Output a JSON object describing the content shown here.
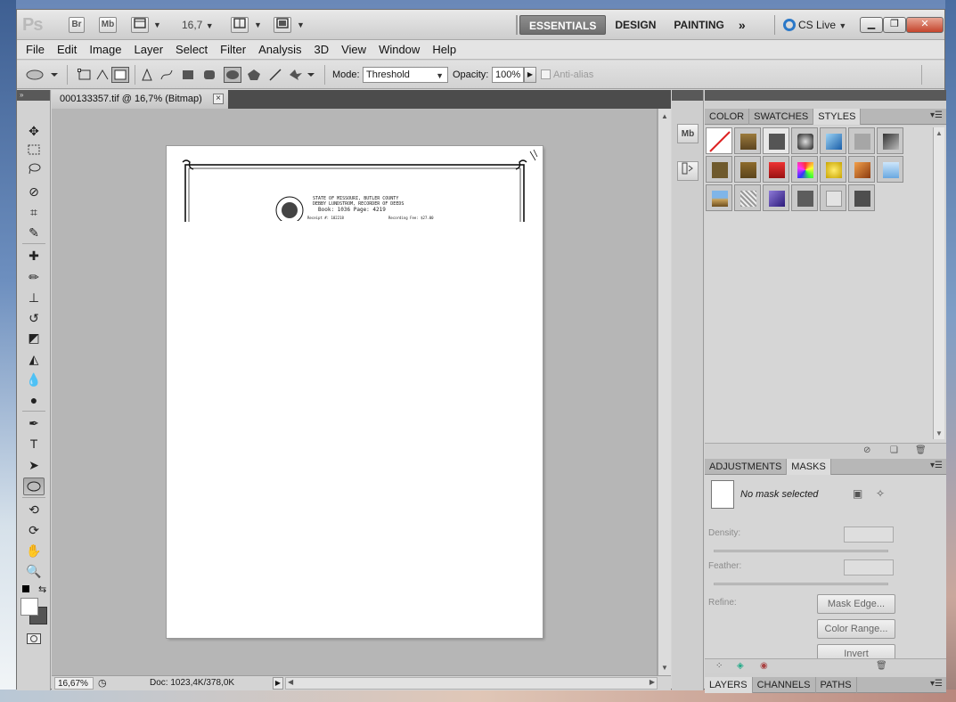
{
  "app": {
    "logo": "Ps",
    "bridge_label": "Br",
    "minibridge_label": "Mb",
    "zoom_value": "16,7",
    "workspaces": [
      "ESSENTIALS",
      "DESIGN",
      "PAINTING"
    ],
    "workspace_more": "»",
    "cs_live": "CS Live"
  },
  "menu": [
    "File",
    "Edit",
    "Image",
    "Layer",
    "Select",
    "Filter",
    "Analysis",
    "3D",
    "View",
    "Window",
    "Help"
  ],
  "options": {
    "mode_label": "Mode:",
    "mode_value": "Threshold",
    "opacity_label": "Opacity:",
    "opacity_value": "100%",
    "antialias_label": "Anti-alias"
  },
  "document": {
    "tab_title": "000133357.tif @ 16,7% (Bitmap)",
    "header_line1": "STATE OF MISSOURI, BUTLER COUNTY",
    "header_line2": "DEBBY LUNDSTROM, RECORDER OF DEEDS",
    "book_line": "Book: 1036  Page: 4219",
    "receipt_line": "Receipt #: 182218",
    "fee_line": "Recording Fee: $27.00"
  },
  "status": {
    "zoom": "16,67%",
    "doc_info": "Doc: 1023,4K/378,0K"
  },
  "panels": {
    "top_tabs": [
      "COLOR",
      "SWATCHES",
      "STYLES"
    ],
    "middle_tabs": [
      "ADJUSTMENTS",
      "MASKS"
    ],
    "bottom_tabs": [
      "LAYERS",
      "CHANNELS",
      "PATHS"
    ],
    "mask_status": "No mask selected",
    "density_label": "Density:",
    "feather_label": "Feather:",
    "refine_label": "Refine:",
    "mask_edge": "Mask Edge...",
    "color_range": "Color Range...",
    "invert": "Invert"
  },
  "colors": {
    "accent": "#2a78c8",
    "close_button": "#c4442b",
    "canvas_bg": "#b6b6b6"
  }
}
